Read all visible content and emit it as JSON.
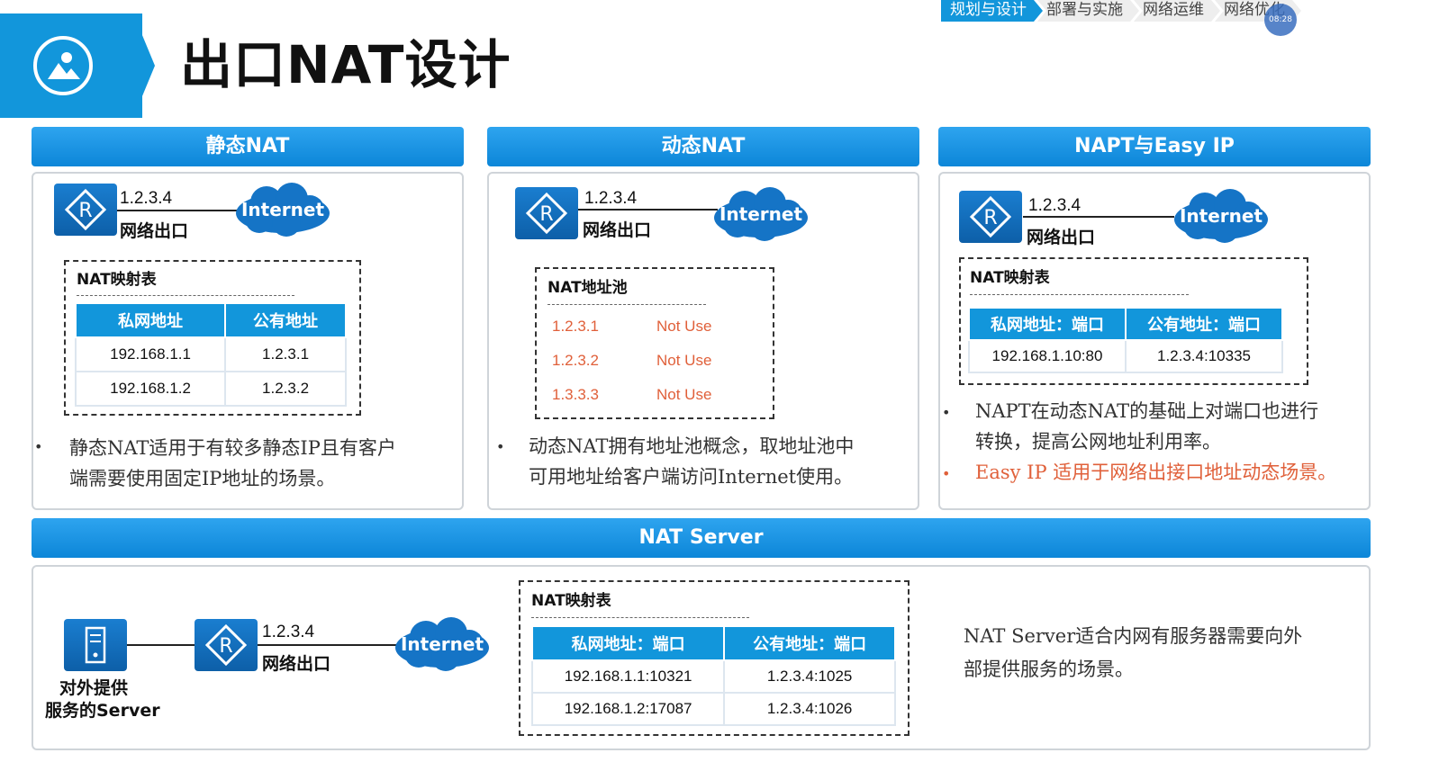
{
  "header": {
    "title": "出口NAT设计"
  },
  "breadcrumbs": [
    "规划与设计",
    "部署与实施",
    "网络运维",
    "网络优化"
  ],
  "clock": "08:28",
  "common": {
    "router_ip": "1.2.3.4",
    "exit_label": "网络出口",
    "cloud_label": "Internet"
  },
  "static_nat": {
    "header": "静态NAT",
    "table_title": "NAT映射表",
    "columns": [
      "私网地址",
      "公有地址"
    ],
    "rows": [
      [
        "192.168.1.1",
        "1.2.3.1"
      ],
      [
        "192.168.1.2",
        "1.2.3.2"
      ]
    ],
    "desc_line1": "静态NAT适用于有较多静态IP且有客户",
    "desc_line2": "端需要使用固定IP地址的场景。"
  },
  "dynamic_nat": {
    "header": "动态NAT",
    "pool_title": "NAT地址池",
    "pool": [
      [
        "1.2.3.1",
        "Not Use"
      ],
      [
        "1.2.3.2",
        "Not Use"
      ],
      [
        "1.3.3.3",
        "Not Use"
      ]
    ],
    "desc_line1": "动态NAT拥有地址池概念，取地址池中",
    "desc_line2": "可用地址给客户端访问Internet使用。"
  },
  "napt": {
    "header": "NAPT与Easy IP",
    "table_title": "NAT映射表",
    "columns": [
      "私网地址：端口",
      "公有地址：端口"
    ],
    "rows": [
      [
        "192.168.1.10:80",
        "1.2.3.4:10335"
      ]
    ],
    "desc_line1": "NAPT在动态NAT的基础上对端口也进行",
    "desc_line2": "转换，提高公网地址利用率。",
    "desc_line3": "Easy IP 适用于网络出接口地址动态场景。"
  },
  "nat_server": {
    "header": "NAT Server",
    "server_label_1": "对外提供",
    "server_label_2": "服务的Server",
    "table_title": "NAT映射表",
    "columns": [
      "私网地址：端口",
      "公有地址：端口"
    ],
    "rows": [
      [
        "192.168.1.1:10321",
        "1.2.3.4:1025"
      ],
      [
        "192.168.1.2:17087",
        "1.2.3.4:1026"
      ]
    ],
    "desc_line1": "NAT Server适合内网有服务器需要向外",
    "desc_line2": "部提供服务的场景。"
  },
  "colors": {
    "accent": "#1296db",
    "pool_text": "#e0603a"
  }
}
